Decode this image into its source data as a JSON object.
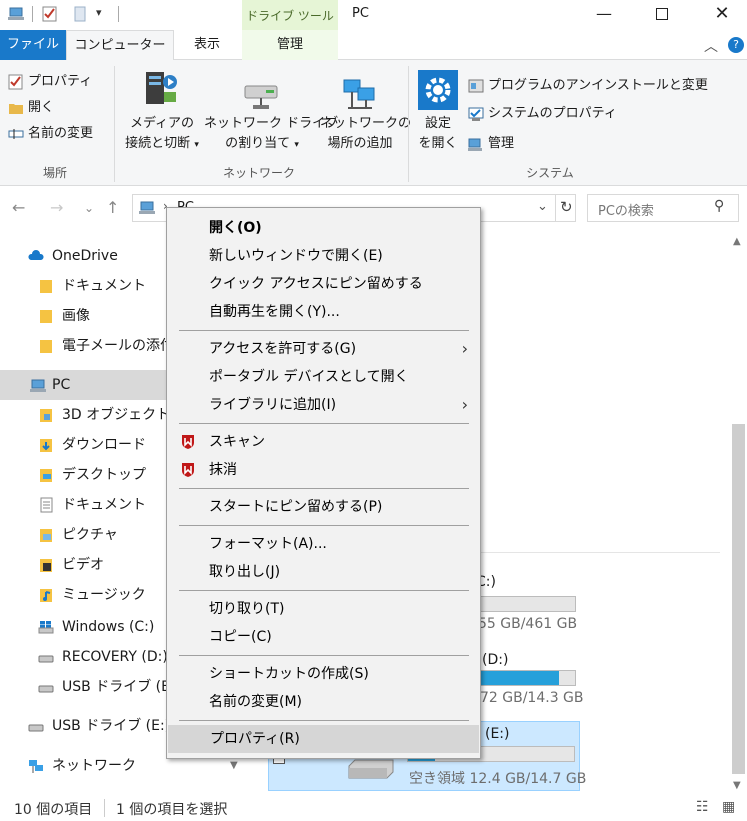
{
  "window": {
    "title": "PC",
    "context_tab": "ドライブ ツール"
  },
  "tabs": {
    "file": "ファイル",
    "computer": "コンピューター",
    "view": "表示",
    "manage": "管理"
  },
  "ribbon": {
    "location": {
      "properties": "プロパティ",
      "open": "開く",
      "rename": "名前の変更",
      "group": "場所"
    },
    "network": {
      "media_l1": "メディアの",
      "media_l2": "接続と切断",
      "map_l1": "ネットワーク ドライブ",
      "map_l2": "の割り当て",
      "add_l1": "ネットワークの",
      "add_l2": "場所の追加",
      "group": "ネットワーク"
    },
    "system": {
      "settings_l1": "設定",
      "settings_l2": "を開く",
      "uninstall": "プログラムのアンインストールと変更",
      "sysprops": "システムのプロパティ",
      "manage": "管理",
      "group": "システム"
    }
  },
  "address": {
    "path": "PC",
    "search_placeholder": "PCの検索"
  },
  "sidebar": {
    "items": [
      {
        "label": "OneDrive"
      },
      {
        "label": "ドキュメント"
      },
      {
        "label": "画像"
      },
      {
        "label": "電子メールの添付"
      },
      {
        "label": "PC"
      },
      {
        "label": "3D オブジェクト"
      },
      {
        "label": "ダウンロード"
      },
      {
        "label": "デスクトップ"
      },
      {
        "label": "ドキュメント"
      },
      {
        "label": "ピクチャ"
      },
      {
        "label": "ビデオ"
      },
      {
        "label": "ミュージック"
      },
      {
        "label": "Windows (C:)"
      },
      {
        "label": "RECOVERY (D:)"
      },
      {
        "label": "USB ドライブ (E:)"
      },
      {
        "label": "USB ドライブ (E:)"
      },
      {
        "label": "ネットワーク"
      }
    ]
  },
  "drives": [
    {
      "name": "C:)",
      "free": "55 GB/461 GB",
      "used_fraction": 0.0
    },
    {
      "name": "(D:)",
      "free": "72 GB/14.3 GB",
      "used_fraction": 0.9
    },
    {
      "name": "(E:)",
      "free": "空き領域 12.4 GB/14.7 GB",
      "used_fraction": 0.16
    }
  ],
  "status": {
    "count": "10 個の項目",
    "selected": "1 個の項目を選択"
  },
  "context_menu": {
    "open": "開く(O)",
    "new_window": "新しいウィンドウで開く(E)",
    "pin_quick": "クイック アクセスにピン留めする",
    "autoplay": "自動再生を開く(Y)...",
    "give_access": "アクセスを許可する(G)",
    "portable": "ポータブル デバイスとして開く",
    "library": "ライブラリに追加(I)",
    "scan": "スキャン",
    "erase": "抹消",
    "pin_start": "スタートにピン留めする(P)",
    "format": "フォーマット(A)...",
    "eject": "取り出し(J)",
    "cut": "切り取り(T)",
    "copy": "コピー(C)",
    "shortcut": "ショートカットの作成(S)",
    "rename": "名前の変更(M)",
    "properties": "プロパティ(R)"
  },
  "colors": {
    "accent": "#1979ca",
    "selection": "#cce8ff",
    "bar": "#26a0da",
    "mcafee": "#c01818"
  }
}
